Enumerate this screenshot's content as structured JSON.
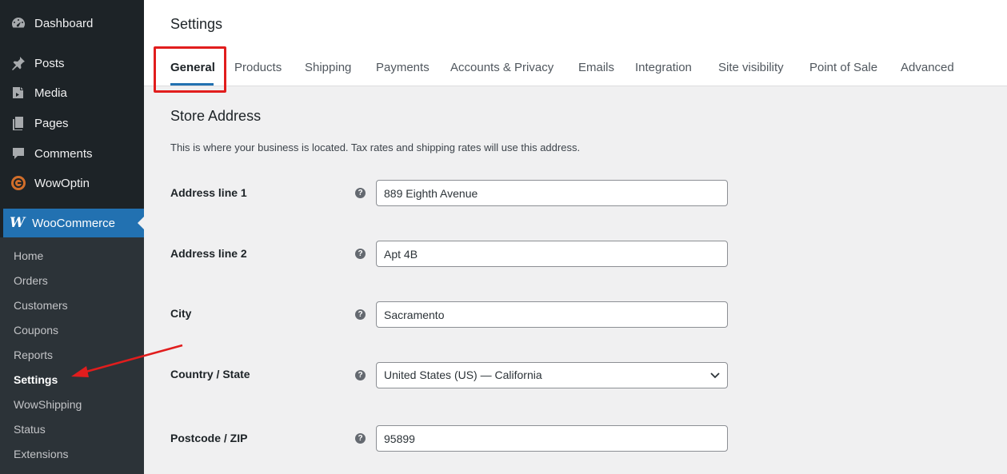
{
  "sidebar": {
    "menu": [
      {
        "label": "Dashboard",
        "icon": "dashboard-icon"
      },
      {
        "label": "Posts",
        "icon": "pin-icon"
      },
      {
        "label": "Media",
        "icon": "media-icon"
      },
      {
        "label": "Pages",
        "icon": "pages-icon"
      },
      {
        "label": "Comments",
        "icon": "comment-icon"
      },
      {
        "label": "WowOptin",
        "icon": "wowoptin-icon"
      }
    ],
    "woocommerce": {
      "logo": "W",
      "label": "WooCommerce"
    },
    "submenu": [
      {
        "label": "Home"
      },
      {
        "label": "Orders"
      },
      {
        "label": "Customers"
      },
      {
        "label": "Coupons"
      },
      {
        "label": "Reports"
      },
      {
        "label": "Settings"
      },
      {
        "label": "WowShipping"
      },
      {
        "label": "Status"
      },
      {
        "label": "Extensions"
      }
    ]
  },
  "header": {
    "title": "Settings",
    "tabs": [
      {
        "label": "General"
      },
      {
        "label": "Products"
      },
      {
        "label": "Shipping"
      },
      {
        "label": "Payments"
      },
      {
        "label": "Accounts & Privacy"
      },
      {
        "label": "Emails"
      },
      {
        "label": "Integration"
      },
      {
        "label": "Site visibility"
      },
      {
        "label": "Point of Sale"
      },
      {
        "label": "Advanced"
      }
    ]
  },
  "section": {
    "title": "Store Address",
    "description": "This is where your business is located. Tax rates and shipping rates will use this address."
  },
  "fields": [
    {
      "label": "Address line 1",
      "value": "889 Eighth Avenue",
      "help": "?"
    },
    {
      "label": "Address line 2",
      "value": "Apt 4B",
      "help": "?"
    },
    {
      "label": "City",
      "value": "Sacramento",
      "help": "?"
    },
    {
      "label": "Country / State",
      "value": "United States (US) — California",
      "help": "?"
    },
    {
      "label": "Postcode / ZIP",
      "value": "95899",
      "help": "?"
    }
  ],
  "colors": {
    "sidebar_bg": "#1d2327",
    "submenu_bg": "#2c3338",
    "accent": "#2271b1",
    "annotation": "#e11d1d"
  }
}
